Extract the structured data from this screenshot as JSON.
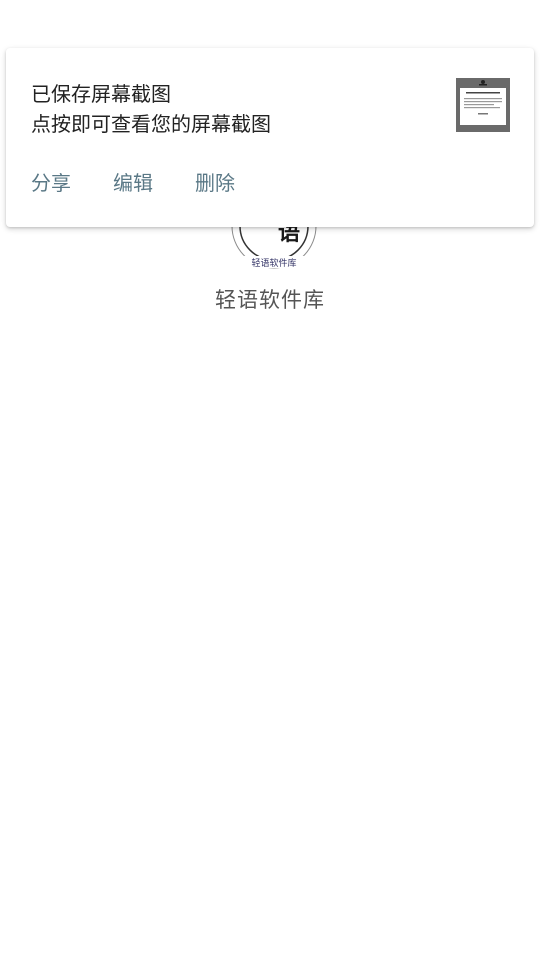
{
  "app": {
    "name": "轻语软件库",
    "logo_text": "轻语软件库"
  },
  "notification": {
    "title": "已保存屏幕截图",
    "text": "点按即可查看您的屏幕截图",
    "actions": [
      {
        "label": "分享"
      },
      {
        "label": "编辑"
      },
      {
        "label": "删除"
      }
    ],
    "action_color": "#5a7886"
  }
}
